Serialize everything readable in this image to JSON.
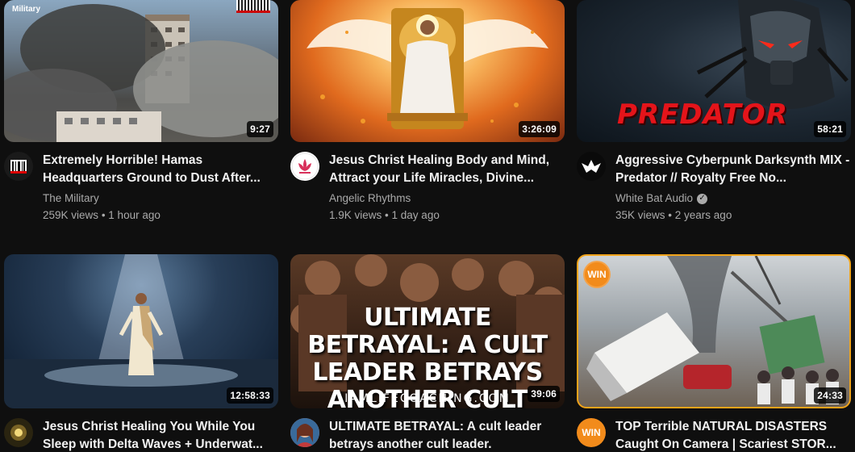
{
  "videos": [
    {
      "title": "Extremely Horrible! Hamas Headquarters Ground to Dust After...",
      "channel": "The Military",
      "verified": false,
      "views": "259K views",
      "age": "1 hour ago",
      "duration": "9:27",
      "thumb_label": "Military"
    },
    {
      "title": "Jesus Christ Healing Body and Mind, Attract your Life Miracles, Divine...",
      "channel": "Angelic Rhythms",
      "verified": false,
      "views": "1.9K views",
      "age": "1 day ago",
      "duration": "3:26:09"
    },
    {
      "title": "Aggressive Cyberpunk Darksynth MIX - Predator // Royalty Free No...",
      "channel": "White Bat Audio",
      "verified": true,
      "views": "35K views",
      "age": "2 years ago",
      "duration": "58:21",
      "thumb_text": "PREDATOR"
    },
    {
      "title": "Jesus Christ Healing You While You Sleep with Delta Waves + Underwat...",
      "channel": "",
      "duration": "12:58:33"
    },
    {
      "title": "ULTIMATE BETRAYAL: A cult leader betrays another cult leader.",
      "channel": "",
      "duration": "39:06",
      "thumb_text": "ULTIMATE BETRAYAL: A CULT LEADER BETRAYS ANOTHER CULT LEADER.",
      "thumb_site": "IAMLIFECOACHING.COM"
    },
    {
      "title": "TOP Terrible NATURAL DISASTERS Caught On Camera | Scariest STOR...",
      "channel": "",
      "duration": "24:33",
      "badge": "WIN"
    }
  ],
  "separator": "•",
  "verified_icon": "✓",
  "colors": {
    "background": "#0f0f0f",
    "text_primary": "#f1f1f1",
    "text_secondary": "#aaaaaa",
    "win_orange": "#f28b1b"
  }
}
